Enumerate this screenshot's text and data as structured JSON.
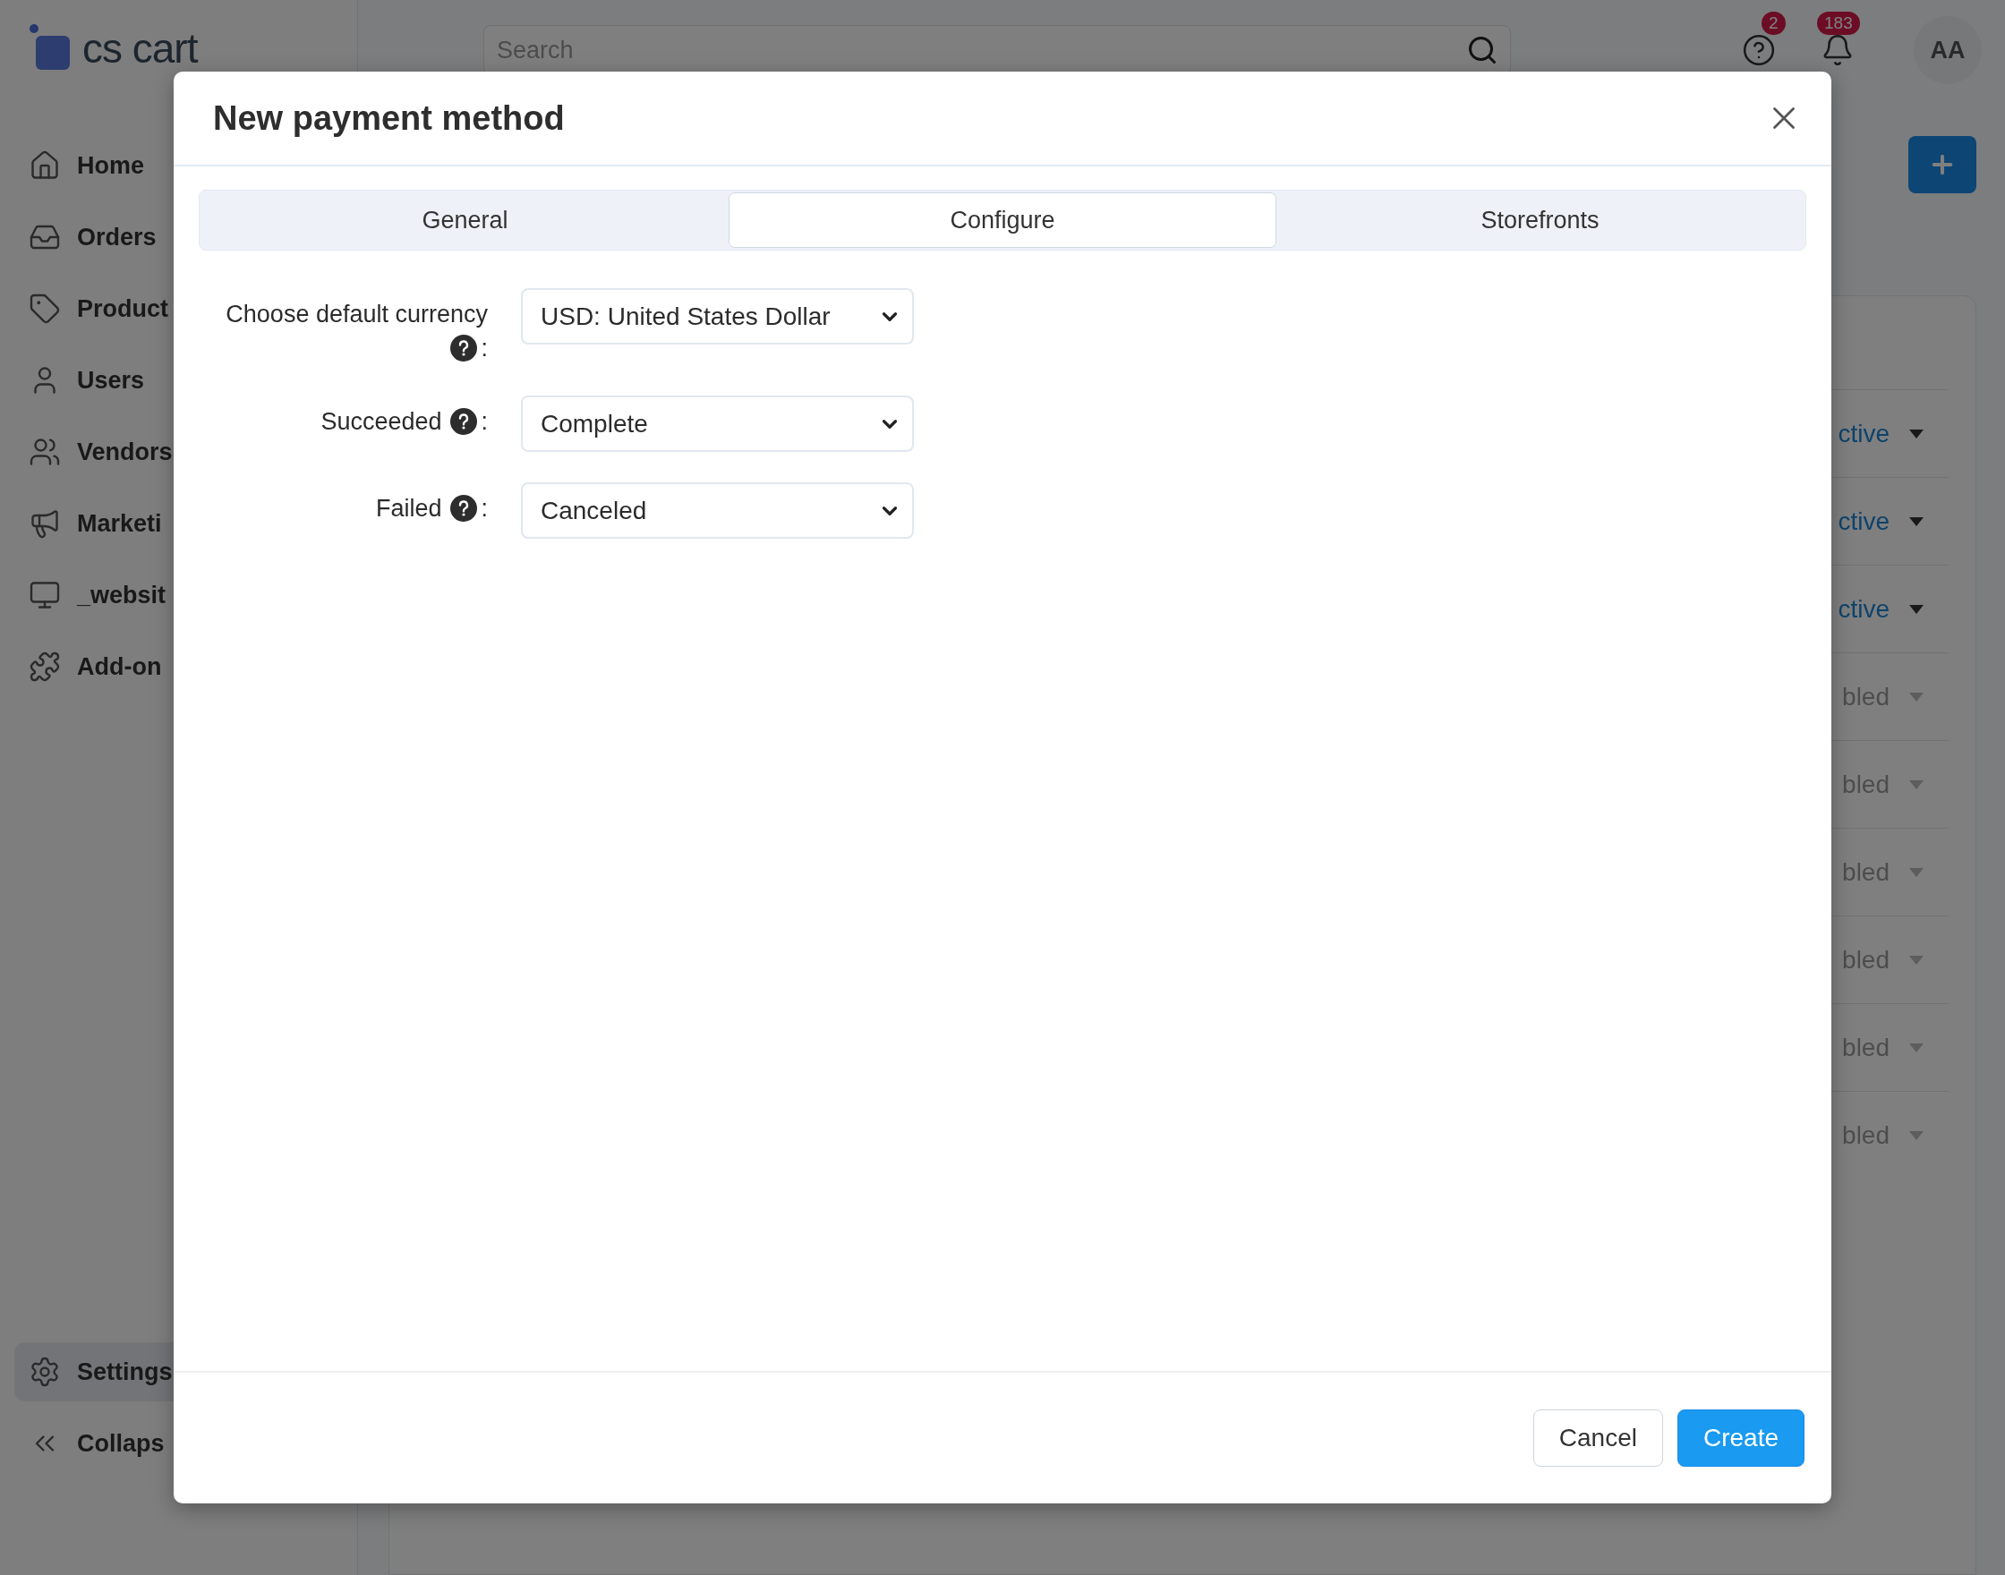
{
  "logo": {
    "text": "cs cart"
  },
  "search": {
    "placeholder": "Search"
  },
  "header_icons": [
    {
      "kind": "help",
      "badge": "2"
    },
    {
      "kind": "bell",
      "badge": "183"
    }
  ],
  "avatar": "AA",
  "sidebar": {
    "items": [
      {
        "label": "Home",
        "kind": "home",
        "selected": false
      },
      {
        "label": "Orders",
        "kind": "inbox",
        "selected": false
      },
      {
        "label": "Product",
        "kind": "tag",
        "selected": false
      },
      {
        "label": "Users",
        "kind": "user",
        "selected": false
      },
      {
        "label": "Vendors",
        "kind": "users",
        "selected": false
      },
      {
        "label": "Marketi",
        "kind": "megaphone",
        "selected": false
      },
      {
        "label": "_websit",
        "kind": "monitor",
        "selected": false
      },
      {
        "label": "Add-on",
        "kind": "puzzle",
        "selected": false
      }
    ],
    "bottom_items": [
      {
        "label": "Settings",
        "kind": "settings",
        "selected": true
      },
      {
        "label": "Collaps",
        "kind": "collapse",
        "selected": false
      }
    ]
  },
  "list": {
    "rows": [
      {
        "status": "ctive",
        "active": true
      },
      {
        "status": "ctive",
        "active": true
      },
      {
        "status": "ctive",
        "active": true
      },
      {
        "status": "bled",
        "active": false
      },
      {
        "status": "bled",
        "active": false
      },
      {
        "status": "bled",
        "active": false
      },
      {
        "status": "bled",
        "active": false
      },
      {
        "status": "bled",
        "active": false
      },
      {
        "status": "bled",
        "active": false
      }
    ]
  },
  "dialog": {
    "title": "New payment method",
    "tabs": [
      {
        "label": "General",
        "selected": false
      },
      {
        "label": "Configure",
        "selected": true
      },
      {
        "label": "Storefronts",
        "selected": false
      }
    ],
    "fields": [
      {
        "label": "Choose default currency",
        "suffix": ":",
        "value": "USD: United States Dollar"
      },
      {
        "label": "Succeeded",
        "suffix": ":",
        "value": "Complete"
      },
      {
        "label": "Failed",
        "suffix": ":",
        "value": "Canceled"
      }
    ],
    "buttons": [
      {
        "label": "Cancel",
        "kind": "secondary"
      },
      {
        "label": "Create",
        "kind": "primary"
      }
    ]
  }
}
